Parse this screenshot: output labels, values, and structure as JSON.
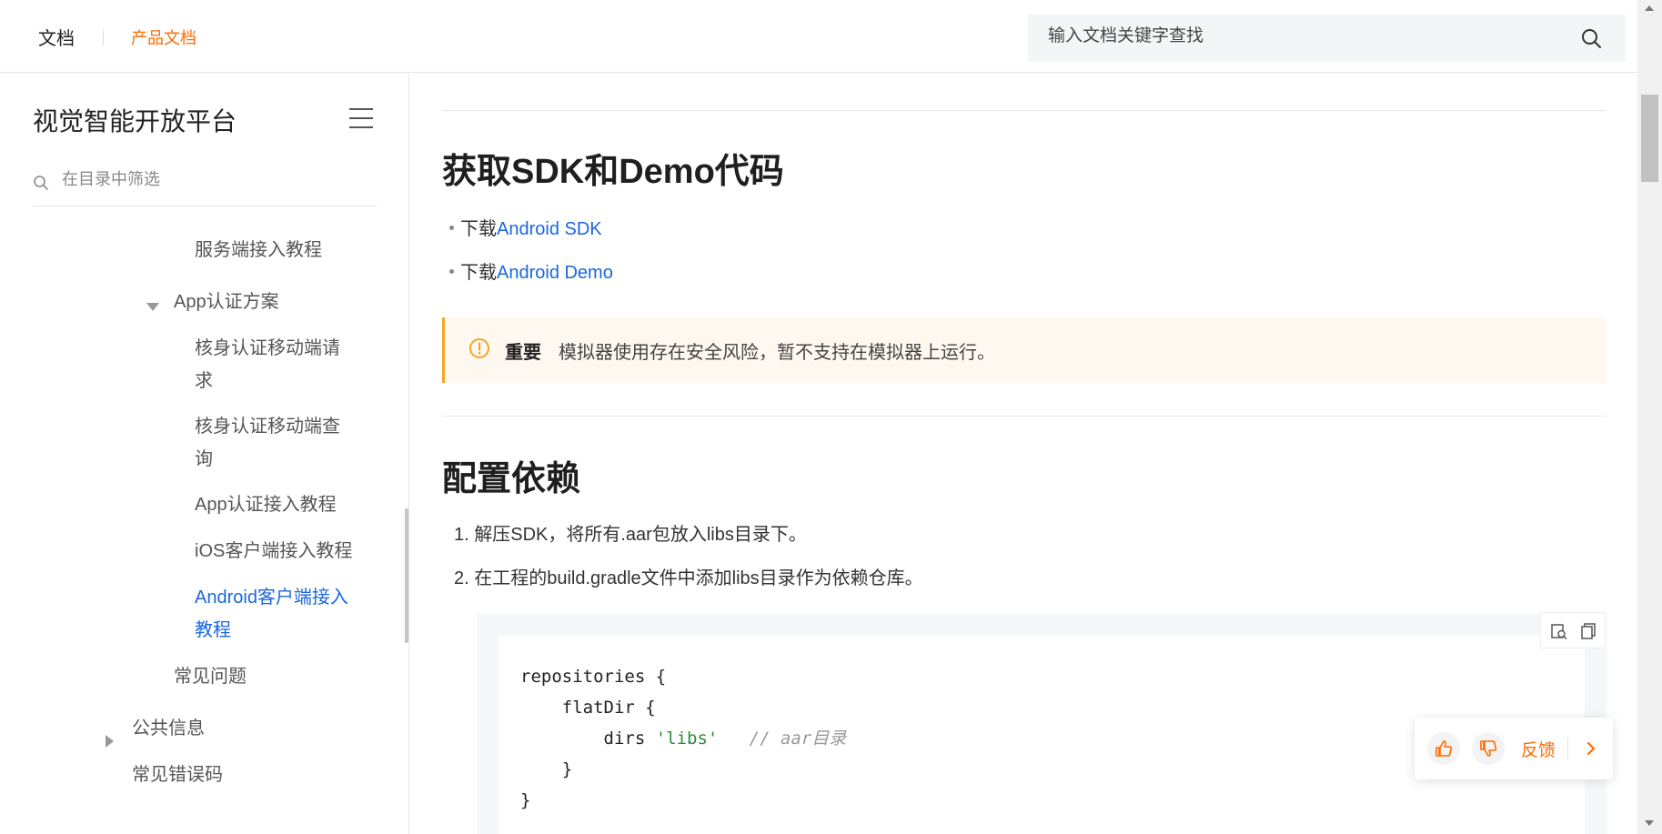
{
  "header": {
    "nav_doc": "文档",
    "nav_product": "产品文档",
    "search_placeholder": "输入文档关键字查找"
  },
  "sidebar": {
    "title": "视觉智能开放平台",
    "filter_placeholder": "在目录中筛选",
    "items": [
      {
        "label": "服务端接入教程"
      },
      {
        "label": "App认证方案"
      },
      {
        "label": "核身认证移动端请求"
      },
      {
        "label": "核身认证移动端查询"
      },
      {
        "label": "App认证接入教程"
      },
      {
        "label": "iOS客户端接入教程"
      },
      {
        "label": "Android客户端接入教程",
        "active": true
      },
      {
        "label": "常见问题"
      },
      {
        "label": "公共信息"
      },
      {
        "label": "常见错误码"
      }
    ]
  },
  "content": {
    "section1_title": "获取SDK和Demo代码",
    "bullets": [
      {
        "prefix": "下载",
        "link": "Android SDK"
      },
      {
        "prefix": "下载",
        "link": "Android Demo"
      }
    ],
    "notice": {
      "title": "重要",
      "text": "模拟器使用存在安全风险，暂不支持在模拟器上运行。"
    },
    "section2_title": "配置依赖",
    "steps": [
      "1. 解压SDK，将所有.aar包放入libs目录下。",
      "2. 在工程的build.gradle文件中添加libs目录作为依赖仓库。"
    ],
    "code": {
      "line1": "repositories {",
      "line2_a": "    flatDir {",
      "line3_a": "        dirs ",
      "line3_str": "'libs'",
      "line3_cmt": "   // aar目录",
      "line4": "    }",
      "line5": "}"
    }
  },
  "feedback": {
    "label": "反馈"
  },
  "colors": {
    "accent_orange": "#ff6a00",
    "link_blue": "#1a66e0",
    "notice_bg": "#fff8f0",
    "notice_border": "#f5a623"
  }
}
